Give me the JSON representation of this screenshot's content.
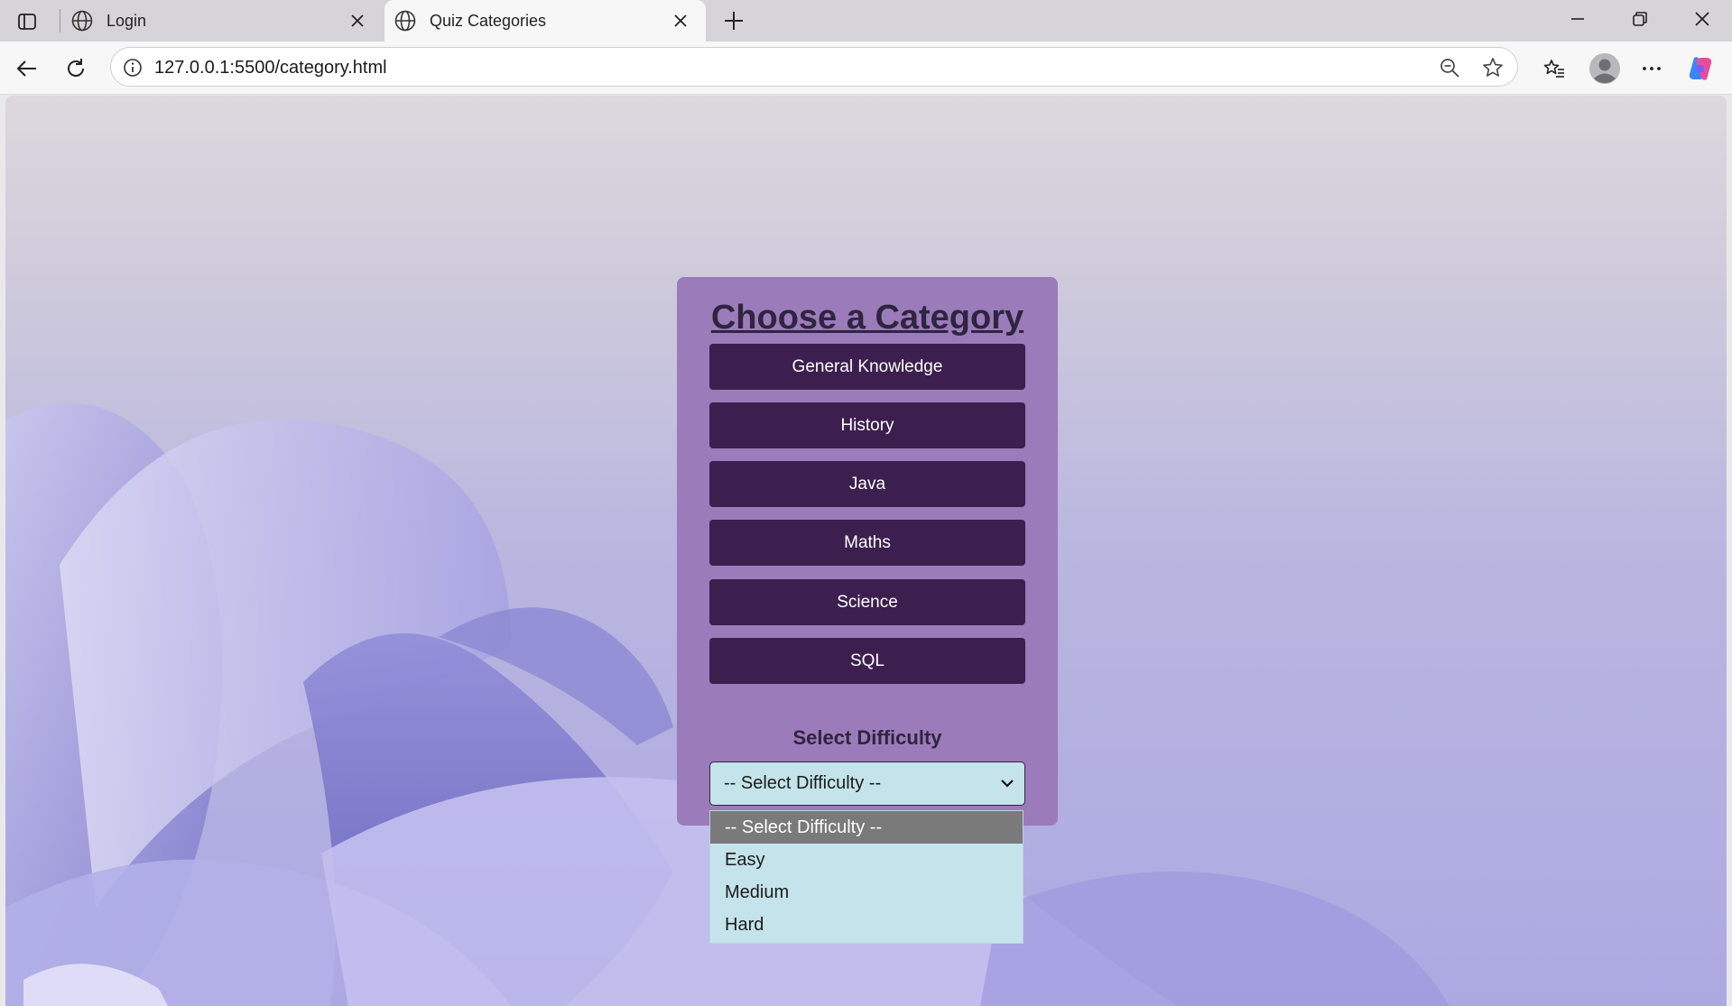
{
  "browser": {
    "tabs": [
      {
        "title": "Login",
        "active": false
      },
      {
        "title": "Quiz Categories",
        "active": true
      }
    ],
    "url": "127.0.0.1:5500/category.html",
    "icons": [
      "sidebar-icon",
      "globe-icon",
      "close-icon",
      "plus-icon",
      "minimize-icon",
      "restore-icon",
      "back-icon",
      "refresh-icon",
      "info-icon",
      "zoom-out-icon",
      "star-icon",
      "favorites-icon",
      "profile-icon",
      "more-icon",
      "copilot-icon"
    ]
  },
  "page": {
    "heading": "Choose a Category",
    "categories": [
      "General Knowledge",
      "History",
      "Java",
      "Maths",
      "Science",
      "SQL"
    ],
    "difficulty_label": "Select Difficulty",
    "difficulty_selected": "-- Select Difficulty --",
    "difficulty_options": [
      "-- Select Difficulty --",
      "Easy",
      "Medium",
      "Hard"
    ]
  },
  "colors": {
    "card": "#9b7bb9",
    "button": "#3c1f4f",
    "select": "#c4e3eb",
    "highlight_option": "#7a7a7a"
  }
}
